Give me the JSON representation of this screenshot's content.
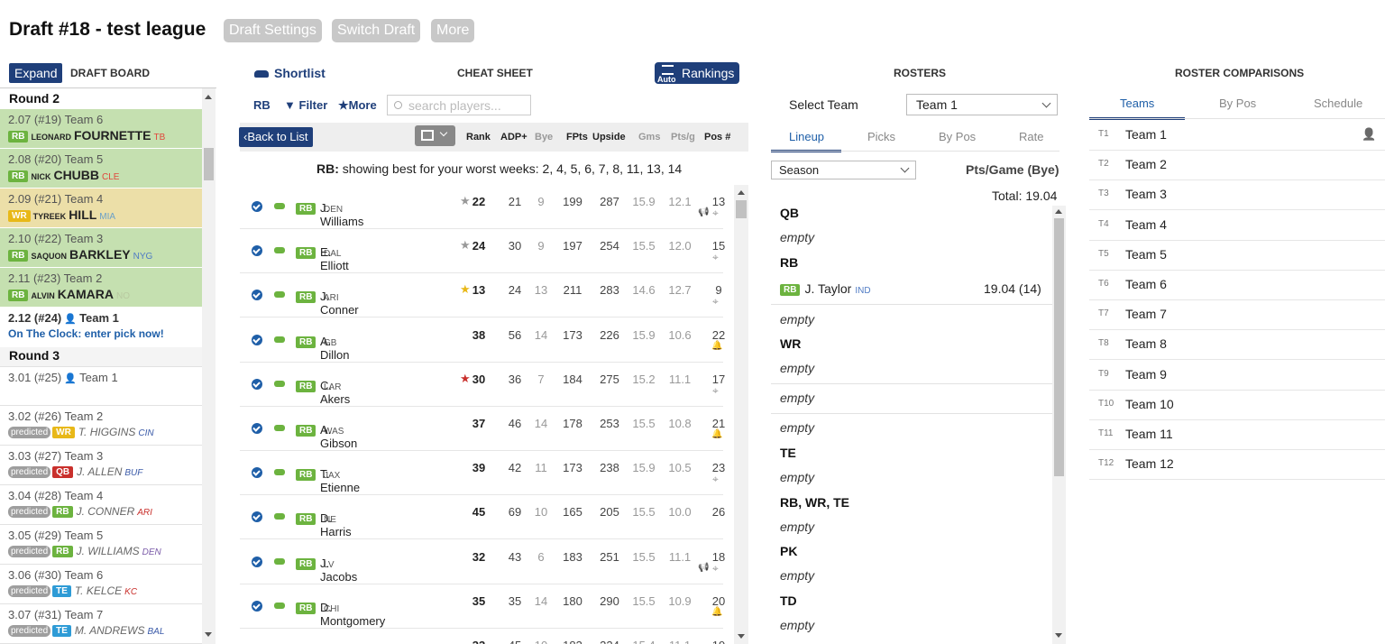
{
  "header": {
    "title": "Draft #18 - test league",
    "buttons": [
      "Draft Settings",
      "Switch Draft",
      "More"
    ]
  },
  "colors": {
    "navy": "#1f3f7a",
    "green_row": "#c5e0b0",
    "yellow_row": "#ecdfa8",
    "rb": "#6cb33f",
    "wr": "#e8b818",
    "qb": "#c9302c",
    "te": "#2e9bd6"
  },
  "board": {
    "expand": "Expand",
    "title": "DRAFT BOARD",
    "round2": "Round 2",
    "round3": "Round 3",
    "made": [
      {
        "pick": "2.07 (#19) Team 6",
        "pos": "RB",
        "first": "LEONARD",
        "last": "FOURNETTE",
        "team": "TB"
      },
      {
        "pick": "2.08 (#20) Team 5",
        "pos": "RB",
        "first": "NICK",
        "last": "CHUBB",
        "team": "CLE"
      },
      {
        "pick": "2.09 (#21) Team 4",
        "pos": "WR",
        "first": "TYREEK",
        "last": "HILL",
        "team": "MIA"
      },
      {
        "pick": "2.10 (#22) Team 3",
        "pos": "RB",
        "first": "SAQUON",
        "last": "BARKLEY",
        "team": "NYG"
      },
      {
        "pick": "2.11 (#23) Team 2",
        "pos": "RB",
        "first": "ALVIN",
        "last": "KAMARA",
        "team": "NO"
      }
    ],
    "current": {
      "pick": "2.12 (#24)",
      "team": "Team 1",
      "clock": "On The Clock: enter pick now!"
    },
    "r3first": {
      "pick": "3.01 (#25)",
      "team": "Team 1"
    },
    "predicted_label": "predicted",
    "predicted": [
      {
        "pick": "3.02 (#26) Team 2",
        "pos": "WR",
        "name": "T. HIGGINS",
        "team": "CIN"
      },
      {
        "pick": "3.03 (#27) Team 3",
        "pos": "QB",
        "name": "J. ALLEN",
        "team": "BUF"
      },
      {
        "pick": "3.04 (#28) Team 4",
        "pos": "RB",
        "name": "J. CONNER",
        "team": "ARI"
      },
      {
        "pick": "3.05 (#29) Team 5",
        "pos": "RB",
        "name": "J. WILLIAMS",
        "team": "DEN"
      },
      {
        "pick": "3.06 (#30) Team 6",
        "pos": "TE",
        "name": "T. KELCE",
        "team": "KC"
      },
      {
        "pick": "3.07 (#31) Team 7",
        "pos": "TE",
        "name": "M. ANDREWS",
        "team": "BAL"
      }
    ]
  },
  "cheat": {
    "shortlist": "Shortlist",
    "title": "CHEAT SHEET",
    "rankings": "Rankings",
    "auto": "Auto",
    "pos": "RB",
    "filter": "Filter",
    "more": "More",
    "search_placeholder": "search players...",
    "back": "Back to List",
    "cols": [
      "Rank",
      "ADP+",
      "Bye",
      "FPts",
      "Upside",
      "Gms",
      "Pts/g",
      "Pos #"
    ],
    "note_pos": "RB:",
    "note": "showing best for your worst weeks: 2, 4, 5, 6, 7, 8, 11, 13, 14",
    "players": [
      {
        "pos": "RB",
        "name": "J. Williams",
        "team": "DEN",
        "star": "gray",
        "rank": "22",
        "adp": "21",
        "bye": "9",
        "fpts": "199",
        "up": "287",
        "gms": "15.9",
        "ptsg": "12.1",
        "posn": "13",
        "icon": "megaphone"
      },
      {
        "pos": "RB",
        "name": "E. Elliott",
        "team": "DAL",
        "star": "gray",
        "rank": "24",
        "adp": "30",
        "bye": "9",
        "fpts": "197",
        "up": "254",
        "gms": "15.5",
        "ptsg": "12.0",
        "posn": "15",
        "icon": "target"
      },
      {
        "pos": "RB",
        "name": "J. Conner",
        "team": "ARI",
        "star": "gold",
        "rank": "13",
        "adp": "24",
        "bye": "13",
        "fpts": "211",
        "up": "283",
        "gms": "14.6",
        "ptsg": "12.7",
        "posn": "9",
        "icon": "target"
      },
      {
        "pos": "RB",
        "name": "A. Dillon",
        "team": "GB",
        "star": "",
        "rank": "38",
        "adp": "56",
        "bye": "14",
        "fpts": "173",
        "up": "226",
        "gms": "15.9",
        "ptsg": "10.6",
        "posn": "22",
        "icon": "bell"
      },
      {
        "pos": "RB",
        "name": "C. Akers",
        "team": "LAR",
        "star": "red",
        "rank": "30",
        "adp": "36",
        "bye": "7",
        "fpts": "184",
        "up": "275",
        "gms": "15.2",
        "ptsg": "11.1",
        "posn": "17",
        "icon": "target"
      },
      {
        "pos": "RB",
        "name": "A. Gibson",
        "team": "WAS",
        "star": "",
        "rank": "37",
        "adp": "46",
        "bye": "14",
        "fpts": "178",
        "up": "253",
        "gms": "15.5",
        "ptsg": "10.8",
        "posn": "21",
        "icon": "bell"
      },
      {
        "pos": "RB",
        "name": "T. Etienne",
        "team": "JAX",
        "star": "",
        "rank": "39",
        "adp": "42",
        "bye": "11",
        "fpts": "173",
        "up": "238",
        "gms": "15.9",
        "ptsg": "10.5",
        "posn": "23",
        "icon": "target"
      },
      {
        "pos": "RB",
        "name": "D. Harris",
        "team": "NE",
        "star": "",
        "rank": "45",
        "adp": "69",
        "bye": "10",
        "fpts": "165",
        "up": "205",
        "gms": "15.5",
        "ptsg": "10.0",
        "posn": "26",
        "icon": ""
      },
      {
        "pos": "RB",
        "name": "J. Jacobs",
        "team": "LV",
        "star": "",
        "rank": "32",
        "adp": "43",
        "bye": "6",
        "fpts": "183",
        "up": "251",
        "gms": "15.5",
        "ptsg": "11.1",
        "posn": "18",
        "icon": "megaphone"
      },
      {
        "pos": "RB",
        "name": "D. Montgomery",
        "team": "CHI",
        "star": "",
        "rank": "35",
        "adp": "35",
        "bye": "14",
        "fpts": "180",
        "up": "290",
        "gms": "15.5",
        "ptsg": "10.9",
        "posn": "20",
        "icon": "bell"
      },
      {
        "pos": "",
        "name": "",
        "team": "",
        "star": "",
        "rank": "33",
        "adp": "45",
        "bye": "10",
        "fpts": "183",
        "up": "224",
        "gms": "15.4",
        "ptsg": "11.1",
        "posn": "19",
        "icon": ""
      }
    ]
  },
  "rosters": {
    "title": "ROSTERS",
    "select_label": "Select Team",
    "team": "Team 1",
    "tabs": [
      "Lineup",
      "Picks",
      "By Pos",
      "Rate"
    ],
    "season": "Season",
    "ptsgame": "Pts/Game (Bye)",
    "total": "Total: 19.04",
    "slots": [
      {
        "label": "QB",
        "value": "empty"
      },
      {
        "label": "RB",
        "pos": "RB",
        "player": "J. Taylor",
        "team": "IND",
        "pts": "19.04 (14)"
      },
      {
        "label": "",
        "value": "empty"
      },
      {
        "label": "WR",
        "value": "empty"
      },
      {
        "label": "",
        "value": "empty"
      },
      {
        "label": "",
        "value": "empty"
      },
      {
        "label": "TE",
        "value": "empty"
      },
      {
        "label": "RB, WR, TE",
        "value": "empty"
      },
      {
        "label": "PK",
        "value": "empty"
      },
      {
        "label": "TD",
        "value": "empty"
      }
    ]
  },
  "comparisons": {
    "title": "ROSTER COMPARISONS",
    "tabs": [
      "Teams",
      "By Pos",
      "Schedule"
    ],
    "teams": [
      {
        "id": "T1",
        "name": "Team 1"
      },
      {
        "id": "T2",
        "name": "Team 2"
      },
      {
        "id": "T3",
        "name": "Team 3"
      },
      {
        "id": "T4",
        "name": "Team 4"
      },
      {
        "id": "T5",
        "name": "Team 5"
      },
      {
        "id": "T6",
        "name": "Team 6"
      },
      {
        "id": "T7",
        "name": "Team 7"
      },
      {
        "id": "T8",
        "name": "Team 8"
      },
      {
        "id": "T9",
        "name": "Team 9"
      },
      {
        "id": "T10",
        "name": "Team 10"
      },
      {
        "id": "T11",
        "name": "Team 11"
      },
      {
        "id": "T12",
        "name": "Team 12"
      }
    ]
  }
}
